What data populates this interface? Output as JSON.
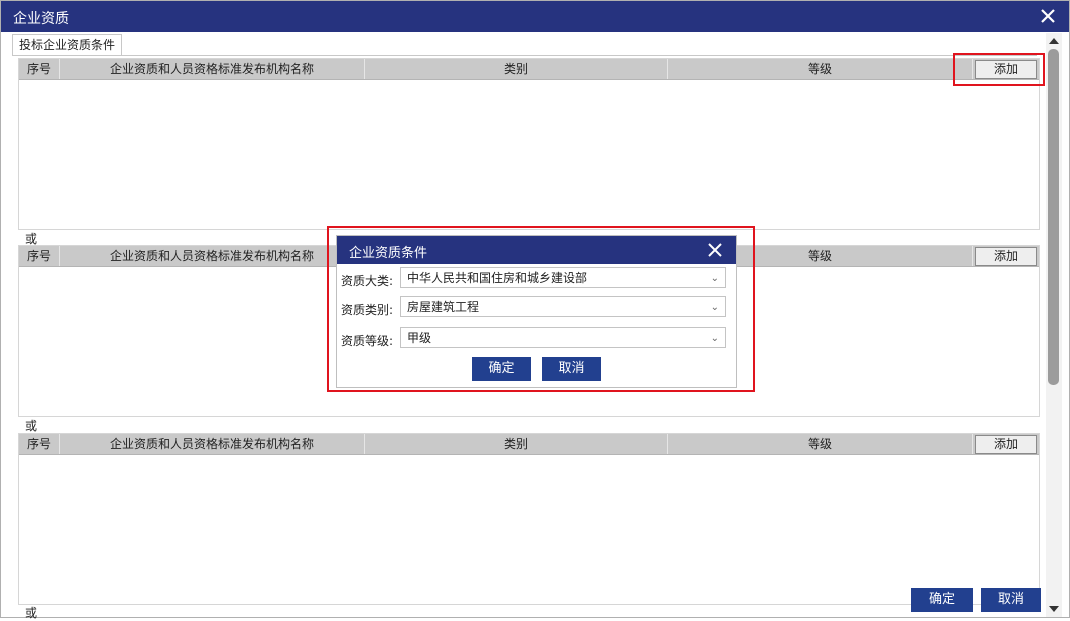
{
  "window": {
    "title": "企业资质"
  },
  "tab": {
    "label": "投标企业资质条件"
  },
  "columns": [
    "序号",
    "企业资质和人员资格标准发布机构名称",
    "类别",
    "等级"
  ],
  "add_label": "添加",
  "or_label": "或",
  "footer": {
    "confirm": "确定",
    "cancel": "取消"
  },
  "dialog": {
    "title": "企业资质条件",
    "fields": [
      {
        "label": "资质大类:",
        "value": "中华人民共和国住房和城乡建设部"
      },
      {
        "label": "资质类别:",
        "value": "房屋建筑工程"
      },
      {
        "label": "资质等级:",
        "value": "甲级"
      }
    ],
    "confirm": "确定",
    "cancel": "取消"
  },
  "colors": {
    "titlebar": "#26337f",
    "button": "#22408f",
    "highlight": "#e0141e",
    "header": "#c9c9c9"
  }
}
